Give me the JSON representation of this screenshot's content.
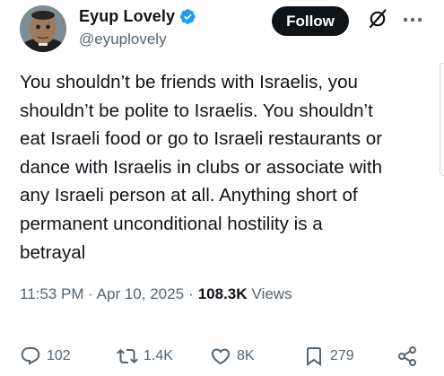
{
  "post": {
    "author": {
      "display_name": "Eyup Lovely",
      "handle": "@eyuplovely",
      "verified": true
    },
    "follow_label": "Follow",
    "text": "You shouldn’t be friends with Israelis, you\nshouldn’t be polite to Israelis. You shouldn’t\neat Israeli food or go to Israeli restaurants or\ndance with Israelis in clubs or associate with\nany Israeli person at all. Anything short of\npermanent unconditional hostility is a\nbetrayal",
    "timestamp": "11:53 PM · Apr 10, 2025",
    "views_count": "108.3K",
    "views_label": "Views",
    "actions": {
      "replies": "102",
      "reposts": "1.4K",
      "likes": "8K",
      "bookmarks": "279"
    }
  },
  "icons": {
    "verified": "verified-badge-icon",
    "grok": "grok-icon",
    "more": "more-icon",
    "reply": "reply-icon",
    "repost": "repost-icon",
    "like": "heart-icon",
    "bookmark": "bookmark-icon",
    "share": "share-icon"
  },
  "colors": {
    "verified": "#1d9bf0",
    "text": "#0f1419",
    "muted": "#536471",
    "button_bg": "#0f1419"
  }
}
